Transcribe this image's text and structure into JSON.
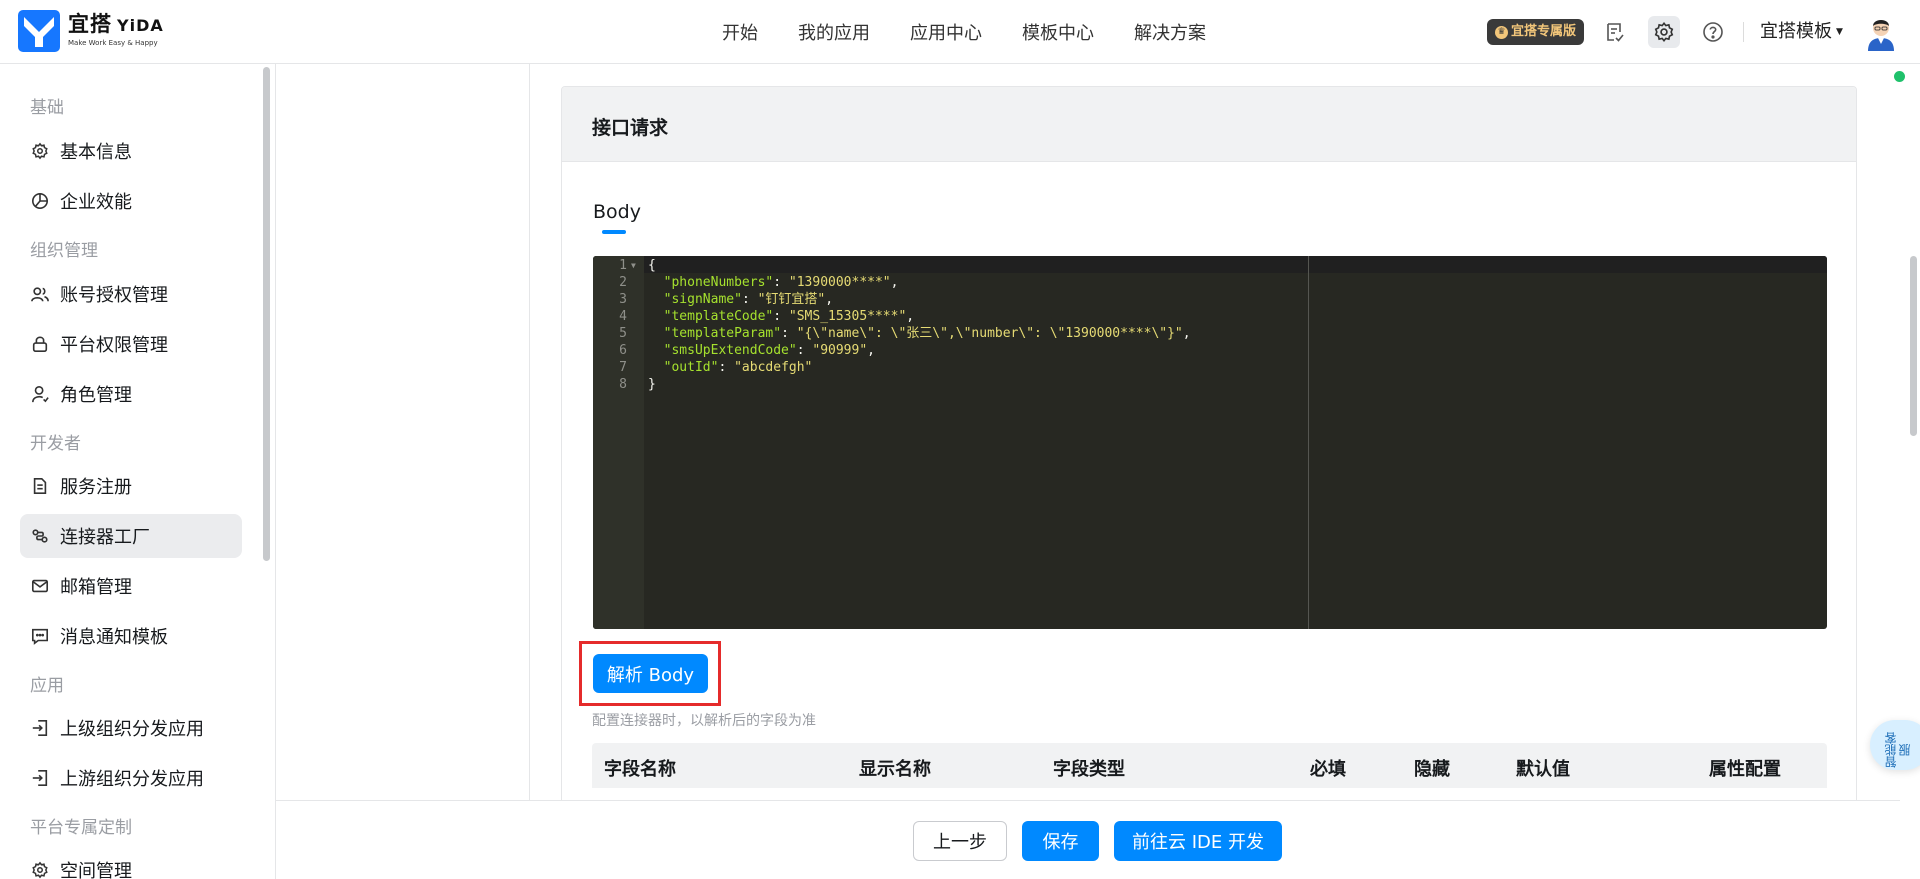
{
  "app": {
    "logo_cn": "宜搭",
    "logo_en": "YiDA",
    "logo_tagline": "Make Work Easy & Happy",
    "brand_color": "#1677ff"
  },
  "nav": {
    "items": [
      "开始",
      "我的应用",
      "应用中心",
      "模板中心",
      "解决方案"
    ]
  },
  "header": {
    "pro_badge": "宜搭专属版",
    "template_menu": "宜搭模板"
  },
  "sidebar": {
    "sections": [
      {
        "title": "基础",
        "items": [
          {
            "label": "基本信息",
            "icon": "gear-icon"
          },
          {
            "label": "企业效能",
            "icon": "pie-chart-icon"
          }
        ]
      },
      {
        "title": "组织管理",
        "items": [
          {
            "label": "账号授权管理",
            "icon": "users-icon"
          },
          {
            "label": "平台权限管理",
            "icon": "lock-icon"
          },
          {
            "label": "角色管理",
            "icon": "user-role-icon"
          }
        ]
      },
      {
        "title": "开发者",
        "items": [
          {
            "label": "服务注册",
            "icon": "document-icon"
          },
          {
            "label": "连接器工厂",
            "icon": "connector-icon",
            "active": true
          },
          {
            "label": "邮箱管理",
            "icon": "mail-icon"
          },
          {
            "label": "消息通知模板",
            "icon": "message-icon"
          }
        ]
      },
      {
        "title": "应用",
        "items": [
          {
            "label": "上级组织分发应用",
            "icon": "import-icon"
          },
          {
            "label": "上游组织分发应用",
            "icon": "import-icon"
          }
        ]
      },
      {
        "title": "平台专属定制",
        "items": [
          {
            "label": "空间管理",
            "icon": "gear-icon"
          }
        ]
      }
    ]
  },
  "main": {
    "card_title": "接口请求",
    "tab_label": "Body",
    "code_lines": [
      "{",
      "  \"phoneNumbers\": \"1390000****\",",
      "  \"signName\": \"钉钉宜搭\",",
      "  \"templateCode\": \"SMS_15305****\",",
      "  \"templateParam\": \"{\\\"name\\\": \\\"张三\\\",\\\"number\\\": \\\"1390000****\\\"}\",",
      "  \"smsUpExtendCode\": \"90999\",",
      "  \"outId\": \"abcdefgh\"",
      "}"
    ],
    "parse_button": "解析 Body",
    "parse_hint": "配置连接器时，以解析后的字段为准",
    "table_headers": [
      "字段名称",
      "显示名称",
      "字段类型",
      "必填",
      "隐藏",
      "默认值",
      "属性配置"
    ]
  },
  "footer": {
    "prev": "上一步",
    "save": "保存",
    "ide": "前往云 IDE 开发"
  },
  "float_help": "智能客服",
  "colors": {
    "primary": "#0089ff",
    "highlight": "#e52b2b",
    "status_dot": "#1fc16b"
  }
}
